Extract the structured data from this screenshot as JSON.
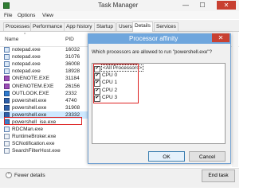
{
  "window": {
    "title": "Task Manager",
    "minimize": "—",
    "maximize": "☐",
    "close": "✕"
  },
  "menu": [
    "File",
    "Options",
    "View"
  ],
  "tabs": [
    "Processes",
    "Performance",
    "App history",
    "Startup",
    "Users",
    "Details",
    "Services"
  ],
  "active_tab": "Details",
  "columns": {
    "name": "Name",
    "pid": "PID",
    "sort_indicator": "^"
  },
  "processes": [
    {
      "name": "notepad.exe",
      "pid": "16032",
      "icon": "notepad-icon"
    },
    {
      "name": "notepad.exe",
      "pid": "31076",
      "icon": "notepad-icon"
    },
    {
      "name": "notepad.exe",
      "pid": "36008",
      "icon": "notepad-icon"
    },
    {
      "name": "notepad.exe",
      "pid": "18928",
      "icon": "notepad-icon"
    },
    {
      "name": "ONENOTE.EXE",
      "pid": "31184",
      "icon": "onenote-icon"
    },
    {
      "name": "ONENOTEM.EXE",
      "pid": "26156",
      "icon": "onenote-icon"
    },
    {
      "name": "OUTLOOK.EXE",
      "pid": "2332",
      "icon": "outlook-icon"
    },
    {
      "name": "powershell.exe",
      "pid": "4740",
      "icon": "powershell-icon"
    },
    {
      "name": "powershell.exe",
      "pid": "31908",
      "icon": "powershell-icon"
    },
    {
      "name": "powershell.exe",
      "pid": "23332",
      "icon": "powershell-icon",
      "selected": true
    },
    {
      "name": "powershell_ise.exe",
      "pid": "",
      "icon": "powershell-ise-icon"
    },
    {
      "name": "RDCMan.exe",
      "pid": "",
      "icon": "rdcman-icon"
    },
    {
      "name": "RuntimeBroker.exe",
      "pid": "",
      "icon": "app-icon"
    },
    {
      "name": "SCNotification.exe",
      "pid": "",
      "icon": "app-icon"
    },
    {
      "name": "SearchFilterHost.exe",
      "pid": "",
      "icon": "app-icon"
    }
  ],
  "footer": {
    "fewer_details": "Fewer details",
    "end_task": "End task"
  },
  "dialog": {
    "title": "Processor affinity",
    "close": "✕",
    "question": "Which processors are allowed to run \"powershell.exe\"?",
    "processors": [
      {
        "label": "<All Processors>",
        "checked": "✔"
      },
      {
        "label": "CPU 0",
        "checked": "✔"
      },
      {
        "label": "CPU 1",
        "checked": "✔"
      },
      {
        "label": "CPU 2",
        "checked": "✔"
      },
      {
        "label": "CPU 3",
        "checked": "✔"
      }
    ],
    "ok": "OK",
    "cancel": "Cancel"
  }
}
